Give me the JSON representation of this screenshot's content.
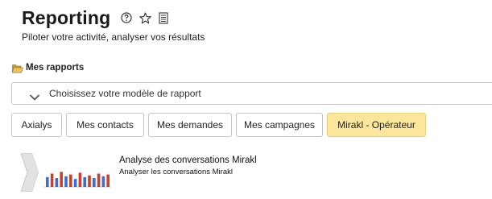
{
  "header": {
    "title": "Reporting",
    "subtitle": "Piloter votre activité, analyser vos résultats",
    "icons": [
      "help-circle-icon",
      "star-outline-icon",
      "document-list-icon"
    ]
  },
  "section": {
    "title": "Mes rapports",
    "icon": "folder-open-icon"
  },
  "report_selector": {
    "placeholder": "Choisissez votre modèle de rapport",
    "icon": "chevron-down-icon"
  },
  "tabs": [
    {
      "label": "Axialys",
      "active": false
    },
    {
      "label": "Mes contacts",
      "active": false
    },
    {
      "label": "Mes demandes",
      "active": false
    },
    {
      "label": "Mes campagnes",
      "active": false
    },
    {
      "label": "Mirakl - Opérateur",
      "active": true
    }
  ],
  "reports": [
    {
      "name": "Analyse des conversations Mirakl",
      "description": "Analyser les conversations Mirakl",
      "icon": "bar-chart-thumbnail-icon"
    }
  ],
  "colors": {
    "active_tab_bg": "#fbe69c",
    "thumb_blue": "#3a6fd0",
    "thumb_red": "#c8402e"
  }
}
